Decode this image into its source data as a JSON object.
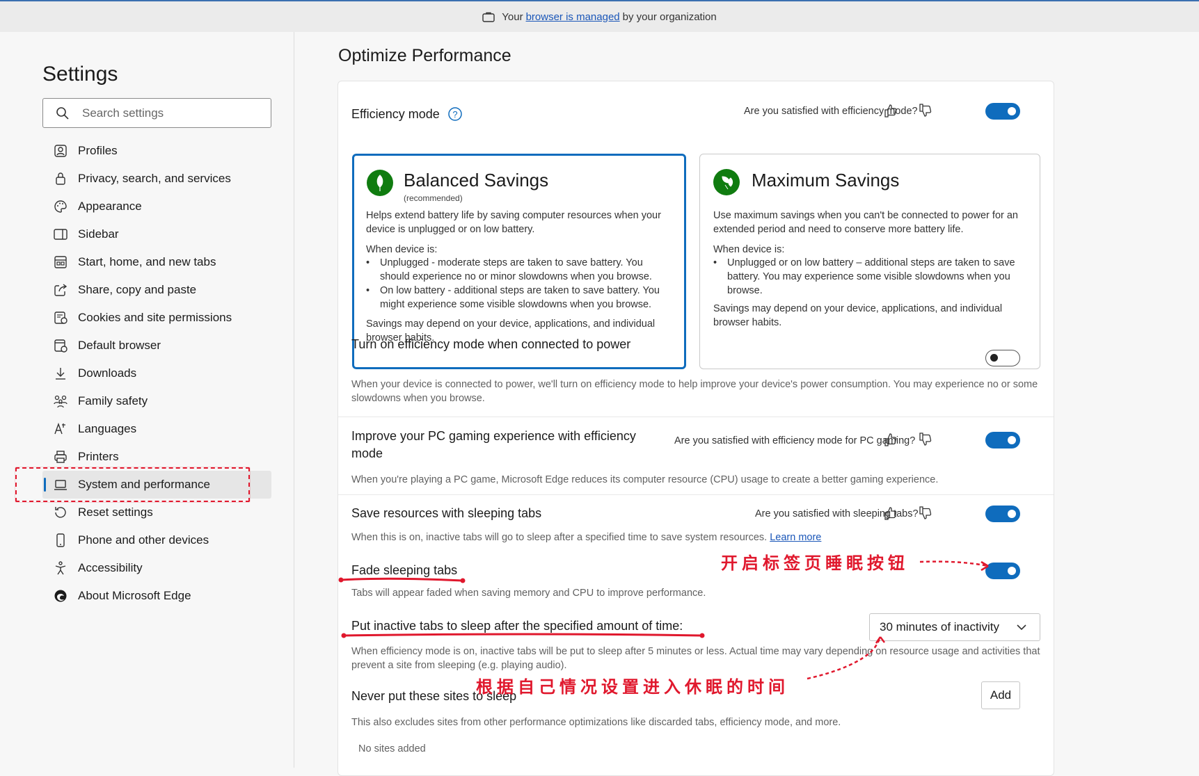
{
  "banner": {
    "prefix": "Your",
    "link": "browser is managed",
    "suffix": "by your organization"
  },
  "sidebar": {
    "title": "Settings",
    "search_placeholder": "Search settings",
    "items": [
      {
        "label": "Profiles",
        "icon": "profile-icon"
      },
      {
        "label": "Privacy, search, and services",
        "icon": "lock-icon"
      },
      {
        "label": "Appearance",
        "icon": "palette-icon"
      },
      {
        "label": "Sidebar",
        "icon": "sidebar-icon"
      },
      {
        "label": "Start, home, and new tabs",
        "icon": "home-tabs-icon"
      },
      {
        "label": "Share, copy and paste",
        "icon": "share-icon"
      },
      {
        "label": "Cookies and site permissions",
        "icon": "cookies-icon"
      },
      {
        "label": "Default browser",
        "icon": "browser-icon"
      },
      {
        "label": "Downloads",
        "icon": "download-icon"
      },
      {
        "label": "Family safety",
        "icon": "family-icon"
      },
      {
        "label": "Languages",
        "icon": "language-icon"
      },
      {
        "label": "Printers",
        "icon": "printer-icon"
      },
      {
        "label": "System and performance",
        "icon": "laptop-icon",
        "active": true
      },
      {
        "label": "Reset settings",
        "icon": "reset-icon"
      },
      {
        "label": "Phone and other devices",
        "icon": "phone-icon"
      },
      {
        "label": "Accessibility",
        "icon": "accessibility-icon"
      },
      {
        "label": "About Microsoft Edge",
        "icon": "edge-icon"
      }
    ]
  },
  "main": {
    "title": "Optimize Performance",
    "efficiency": {
      "title": "Efficiency mode",
      "question": "Are you satisfied with efficiency mode?",
      "enabled": true
    },
    "balanced": {
      "title": "Balanced Savings",
      "subtitle": "(recommended)",
      "description": "Helps extend battery life by saving computer resources when your device is unplugged or on low battery.",
      "when": "When device is:",
      "bullets": [
        "Unplugged - moderate steps are taken to save battery. You should experience no or minor slowdowns when you browse.",
        "On low battery - additional steps are taken to save battery. You might experience some visible slowdowns when you browse."
      ],
      "note": "Savings may depend on your device, applications, and individual browser habits."
    },
    "maximum": {
      "title": "Maximum Savings",
      "description": "Use maximum savings when you can't be connected to power for an extended period and need to conserve more battery life.",
      "when": "When device is:",
      "bullets": [
        "Unplugged or on low battery – additional steps are taken to save battery. You may experience some visible slowdowns when you browse."
      ],
      "note": "Savings may depend on your device, applications, and individual browser habits."
    },
    "power": {
      "title": "Turn on efficiency mode when connected to power",
      "description": "When your device is connected to power, we'll turn on efficiency mode to help improve your device's power consumption. You may experience no or some slowdowns when you browse.",
      "enabled": false
    },
    "gaming": {
      "title": "Improve your PC gaming experience with efficiency mode",
      "question": "Are you satisfied with efficiency mode for PC gaming?",
      "description": "When you're playing a PC game, Microsoft Edge reduces its computer resource (CPU) usage to create a better gaming experience.",
      "enabled": true
    },
    "sleeping": {
      "title": "Save resources with sleeping tabs",
      "question": "Are you satisfied with sleeping tabs?",
      "description": "When this is on, inactive tabs will go to sleep after a specified time to save system resources.",
      "learn_more": "Learn more",
      "enabled": true
    },
    "fade": {
      "title": "Fade sleeping tabs",
      "description": "Tabs will appear faded when saving memory and CPU to improve performance.",
      "enabled": true
    },
    "inactive": {
      "title": "Put inactive tabs to sleep after the specified amount of time:",
      "selected": "30 minutes of inactivity",
      "description": "When efficiency mode is on, inactive tabs will be put to sleep after 5 minutes or less. Actual time may vary depending on resource usage and activities that prevent a site from sleeping (e.g. playing audio)."
    },
    "never": {
      "title": "Never put these sites to sleep",
      "add_label": "Add",
      "description": "This also excludes sites from other performance optimizations like discarded tabs, efficiency mode, and more.",
      "empty": "No sites added"
    }
  },
  "annotations": {
    "toggle_note": "开启标签页睡眠按钮",
    "time_note": "根据自己情况设置进入休眠的时间"
  },
  "colors": {
    "accent": "#0f6cbd",
    "annotation": "#e0182d",
    "leaf_green": "#107c10"
  }
}
